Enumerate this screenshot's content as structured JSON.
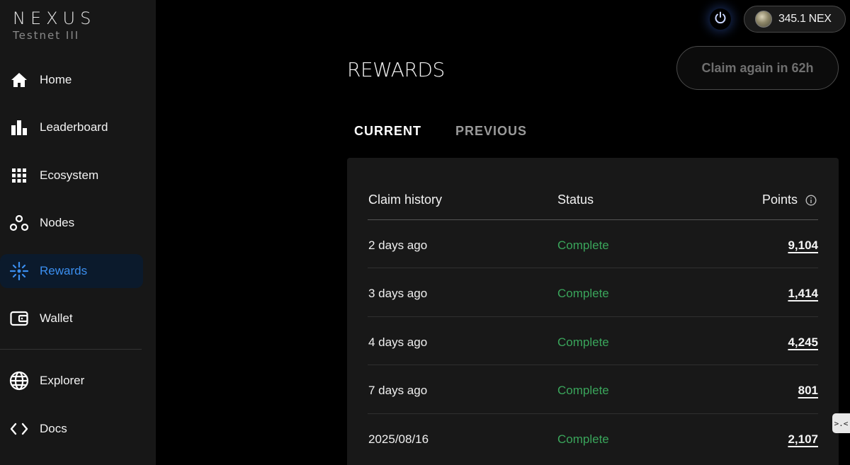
{
  "brand": {
    "name": "NEXUS",
    "subtitle": "Testnet III"
  },
  "sidebar": {
    "items": [
      {
        "label": "Home",
        "icon": "home-icon"
      },
      {
        "label": "Leaderboard",
        "icon": "bar-chart-icon"
      },
      {
        "label": "Ecosystem",
        "icon": "grid-icon"
      },
      {
        "label": "Nodes",
        "icon": "nodes-icon"
      },
      {
        "label": "Rewards",
        "icon": "sparkle-icon",
        "active": true
      },
      {
        "label": "Wallet",
        "icon": "wallet-icon"
      },
      {
        "label": "Explorer",
        "icon": "globe-icon"
      },
      {
        "label": "Docs",
        "icon": "code-icon"
      }
    ]
  },
  "header": {
    "balance": "345.1 NEX"
  },
  "page": {
    "title": "REWARDS",
    "claim_label": "Claim again in 62h"
  },
  "tabs": [
    {
      "label": "CURRENT",
      "active": true
    },
    {
      "label": "PREVIOUS"
    }
  ],
  "table": {
    "headers": {
      "claim": "Claim history",
      "status": "Status",
      "points": "Points"
    },
    "rows": [
      {
        "date": "2 days ago",
        "status": "Complete",
        "points": "9,104"
      },
      {
        "date": "3 days ago",
        "status": "Complete",
        "points": "1,414"
      },
      {
        "date": "4 days ago",
        "status": "Complete",
        "points": "4,245"
      },
      {
        "date": "7 days ago",
        "status": "Complete",
        "points": "801"
      },
      {
        "date": "2025/08/16",
        "status": "Complete",
        "points": "2,107"
      }
    ]
  },
  "colors": {
    "accent": "#3b8ff0",
    "status_complete": "#3aa55b",
    "sidebar_bg": "#171717",
    "card_bg": "#181818"
  }
}
